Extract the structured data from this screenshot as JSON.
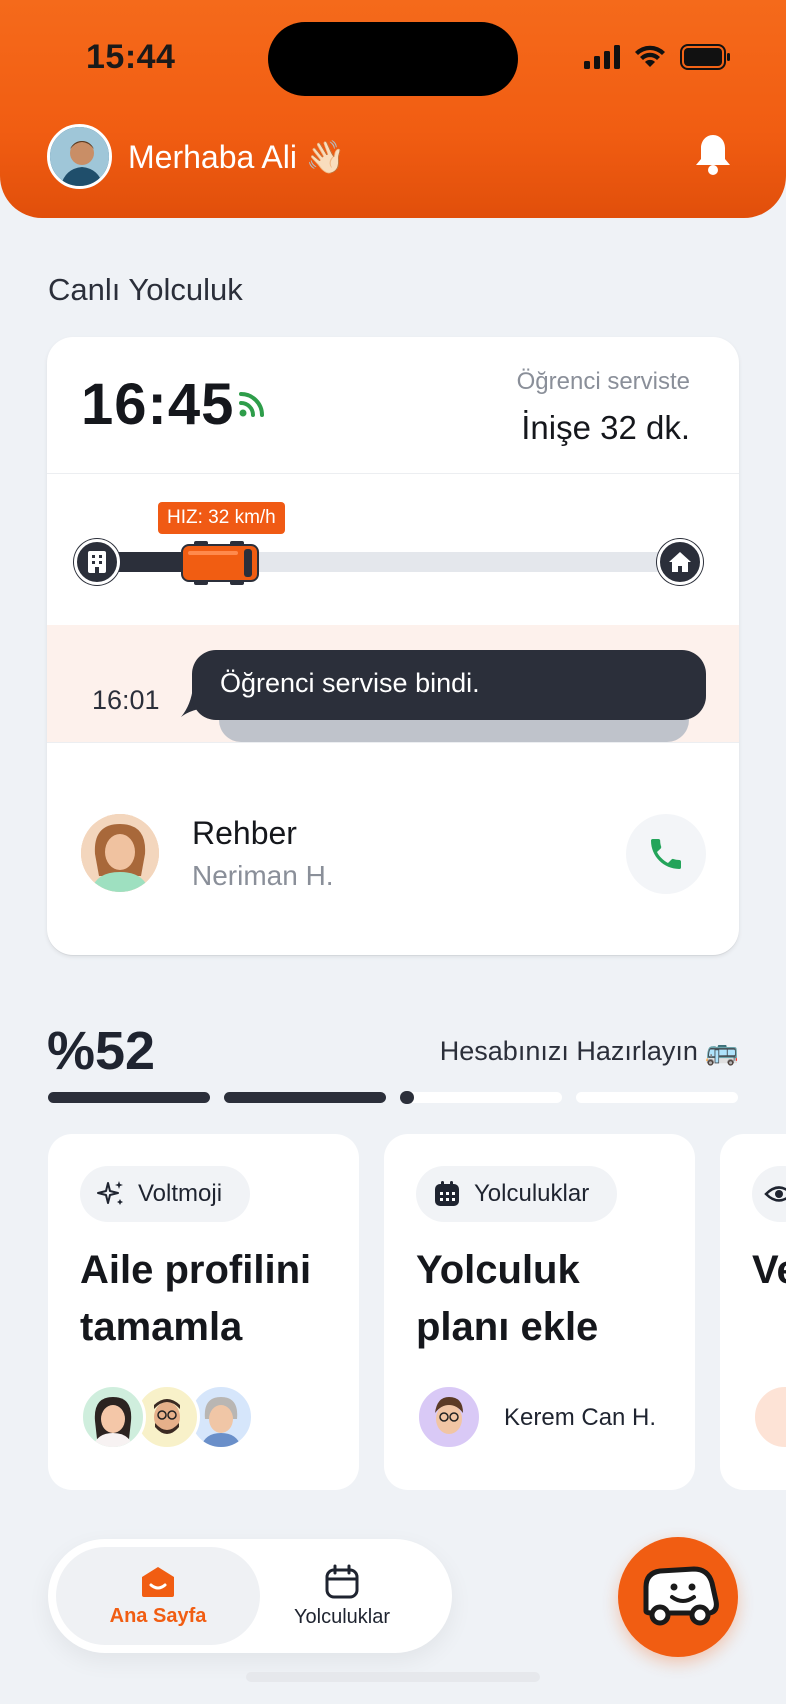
{
  "status_bar": {
    "time": "15:44"
  },
  "header": {
    "greeting": "Merhaba Ali 👋🏻"
  },
  "live": {
    "section_title": "Canlı Yolculuk",
    "time": "16:45",
    "status": "Öğrenci serviste",
    "eta": "İnişe 32 dk.",
    "speed": "HIZ: 32 km/h",
    "route_progress": 0.22,
    "message_time": "16:01",
    "message": "Öğrenci servise bindi.",
    "guide_role": "Rehber",
    "guide_name": "Neriman H."
  },
  "progress": {
    "percent": "%52",
    "label": "Hesabınızı Hazırlayın 🚌",
    "value": 52
  },
  "cards": [
    {
      "chip": "Voltmoji",
      "icon": "sparkles-icon",
      "title": "Aile profilini tamamla"
    },
    {
      "chip": "Yolculuklar",
      "icon": "calendar-icon",
      "title": "Yolculuk planı ekle",
      "person": "Kerem Can H."
    },
    {
      "chip": "",
      "icon": "eye-icon",
      "title": "Ve ek"
    }
  ],
  "nav": {
    "home": "Ana Sayfa",
    "trips": "Yolculuklar"
  },
  "colors": {
    "brand": "#f15d12",
    "dark": "#2b2f3a",
    "call": "#23a45a"
  }
}
